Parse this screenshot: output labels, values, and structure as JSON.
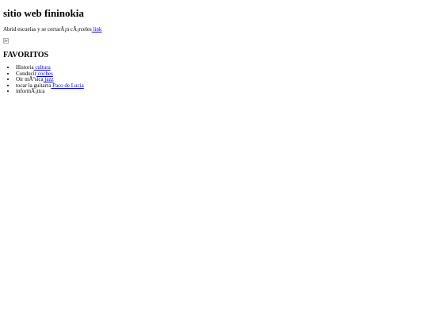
{
  "page": {
    "title": "sitio web fininokia",
    "intro": {
      "text": "Abrid escuelas y se cerrarÃ¡n cÃ¡rceles",
      "link_label": " link"
    },
    "image_icon": "broken-image-icon",
    "favorites_heading": "FAVORITOS",
    "favorites": [
      {
        "text": "Historia",
        "link_label": " cultura"
      },
      {
        "text": "Conducir",
        "link_label": " coches"
      },
      {
        "text": "Oir mÃºsica",
        "link_label": " jazz"
      },
      {
        "text": "tocar la guitarra",
        "link_label": " Paco de Lucia"
      },
      {
        "text": "informÃ¡tica",
        "link_label": ""
      }
    ]
  },
  "colors": {
    "link": "#0000ee",
    "text": "#000000",
    "background": "#ffffff"
  }
}
